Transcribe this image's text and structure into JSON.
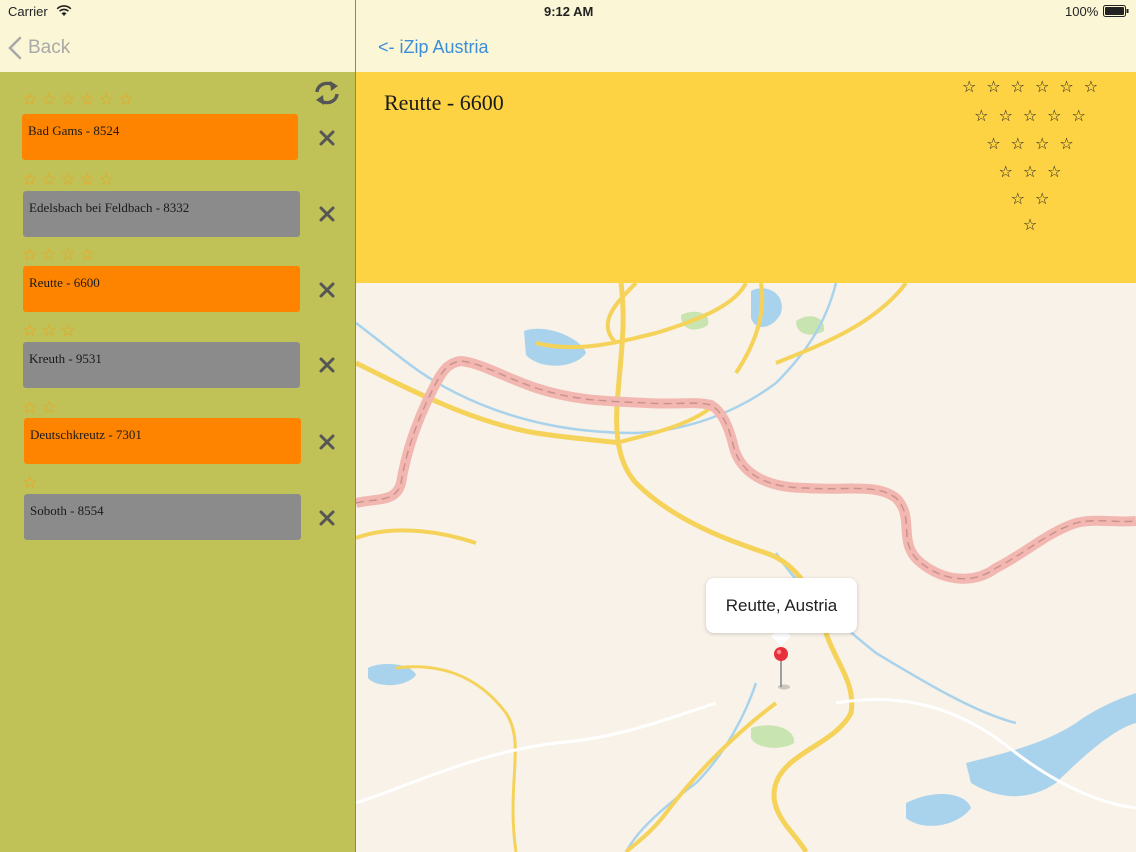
{
  "status_bar": {
    "carrier": "Carrier",
    "time": "9:12 AM",
    "battery": "100%"
  },
  "left_nav": {
    "back_label": "Back"
  },
  "right_nav": {
    "back_label": "<- iZip Austria"
  },
  "list": [
    {
      "rating": 6,
      "stars": "☆☆☆☆☆☆",
      "label": "Bad Gams - 8524",
      "color": "#fe8400"
    },
    {
      "rating": 5,
      "stars": "☆☆☆☆☆",
      "label": "Edelsbach bei Feldbach - 8332",
      "color": "#8b8b8b"
    },
    {
      "rating": 4,
      "stars": "☆☆☆☆",
      "label": "Reutte - 6600",
      "color": "#fe8400"
    },
    {
      "rating": 3,
      "stars": "☆☆☆",
      "label": "Kreuth - 9531",
      "color": "#8b8b8b"
    },
    {
      "rating": 2,
      "stars": "☆☆",
      "label": "Deutschkreutz - 7301",
      "color": "#fe8400"
    },
    {
      "rating": 1,
      "stars": "☆",
      "label": "Soboth - 8554",
      "color": "#8b8b8b"
    }
  ],
  "detail": {
    "title": "Reutte - 6600",
    "star_rows": [
      "☆☆☆☆☆☆",
      "☆☆☆☆☆",
      "☆☆☆☆",
      "☆☆☆",
      "☆☆",
      "☆"
    ]
  },
  "map": {
    "callout": "Reutte, Austria"
  },
  "colors": {
    "left_bg": "#c0c257",
    "nav_bg": "#fbf6d6",
    "header_bg": "#fdd343",
    "orange_row": "#fe8400",
    "gray_row": "#8b8b8b",
    "star_orange": "#f0a01e",
    "link_blue": "#3b8fd9"
  },
  "icons": [
    "back-chevron-icon",
    "refresh-icon",
    "delete-x-icon",
    "wifi-icon",
    "battery-icon",
    "map-pin-icon"
  ]
}
